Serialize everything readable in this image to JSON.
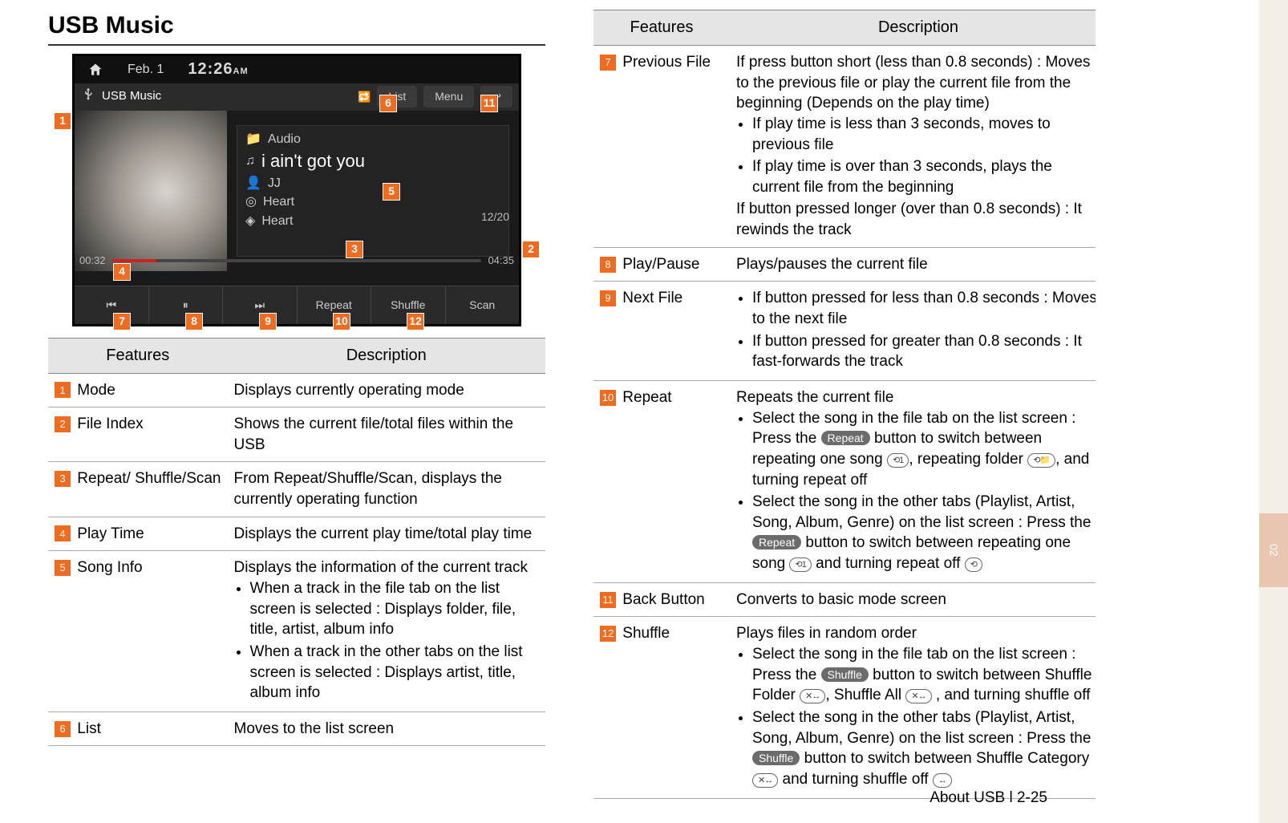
{
  "section_title": "USB Music",
  "device": {
    "date": "Feb. 1",
    "clock": "12:26",
    "ampm": "AM",
    "mode_label": "USB Music",
    "list_btn": "List",
    "menu_btn": "Menu",
    "info": {
      "folder": "Audio",
      "title": "i ain't got you",
      "artist": "JJ",
      "album": "Heart",
      "genre": "Heart"
    },
    "file_index": "12/20",
    "elapsed": "00:32",
    "total": "04:35",
    "controls": {
      "prev": "⏮",
      "pause": "⏸",
      "next": "⏭",
      "repeat": "Repeat",
      "shuffle": "Shuffle",
      "scan": "Scan"
    }
  },
  "table_headers": {
    "features": "Features",
    "description": "Description"
  },
  "left_rows": [
    {
      "n": "1",
      "feature": "Mode",
      "desc_plain": "Displays currently operating mode"
    },
    {
      "n": "2",
      "feature": "File Index",
      "desc_plain": "Shows the current file/total files within the USB"
    },
    {
      "n": "3",
      "feature": "Repeat/ Shuffle/Scan",
      "desc_plain": "From Repeat/Shuffle/Scan, displays the currently operating function"
    },
    {
      "n": "4",
      "feature": "Play Time",
      "desc_plain": "Displays the current play time/total play time"
    },
    {
      "n": "5",
      "feature": "Song Info",
      "desc_intro": "Displays the information of the current track",
      "bullets": [
        "When a track in the file tab on the list screen is selected : Displays folder, file, title, artist, album info",
        "When a track in the other tabs on the list screen is selected : Displays artist, title, album info"
      ]
    },
    {
      "n": "6",
      "feature": "List",
      "desc_plain": "Moves to the list screen"
    }
  ],
  "right_rows": {
    "r7": {
      "n": "7",
      "feature": "Previous File",
      "intro": "If press button short (less than 0.8 seconds) : Moves to the previous file or play the current file from the beginning (Depends on the play time)",
      "b1": "If play time is less than 3 seconds, moves to previous file",
      "b2": "If play time is over than 3 seconds, plays the current file from the beginning",
      "outro": "If button pressed longer (over than 0.8 seconds) : It rewinds the track"
    },
    "r8": {
      "n": "8",
      "feature": "Play/Pause",
      "desc": "Plays/pauses the current file"
    },
    "r9": {
      "n": "9",
      "feature": "Next File",
      "b1": "If button pressed for less than 0.8 seconds : Moves to the next file",
      "b2": "If button pressed for greater than 0.8 seconds : It fast-forwards the track"
    },
    "r10": {
      "n": "10",
      "feature": "Repeat",
      "intro": "Repeats the current file",
      "b1a": "Select the song in the file tab on the list screen : Press the ",
      "b1btn": "Repeat",
      "b1b": " button to switch between repeating one song ",
      "b1c": ", repeating folder ",
      "b1d": ", and turning repeat off",
      "b2a": "Select the song in the other tabs (Playlist, Artist, Song, Album, Genre) on the list screen : Press the ",
      "b2btn": "Repeat",
      "b2b": " button to switch between repeating one song ",
      "b2c": " and turning repeat off "
    },
    "r11": {
      "n": "11",
      "feature": "Back Button",
      "desc": "Converts to basic mode screen"
    },
    "r12": {
      "n": "12",
      "feature": "Shuffle",
      "intro": "Plays files in random order",
      "b1a": "Select the song in the file tab on the list screen : Press the ",
      "b1btn": "Shuffle",
      "b1b": " button to switch between Shuffle Folder ",
      "b1c": ", Shuffle All ",
      "b1d": " , and turning shuffle off",
      "b2a": "Select the song in the other tabs (Playlist, Artist, Song, Album, Genre) on the list screen : Press the ",
      "b2btn": "Shuffle",
      "b2b": " button to switch between Shuffle Category ",
      "b2c": " and turning shuffle off "
    }
  },
  "icons": {
    "repeat_one": "⟲1",
    "repeat_folder": "⟲📁",
    "repeat_off": "⟲",
    "shuffle": "✕↔",
    "shuffle_off": "↔"
  },
  "footer": "About USB l 2-25",
  "side_tab": "02"
}
